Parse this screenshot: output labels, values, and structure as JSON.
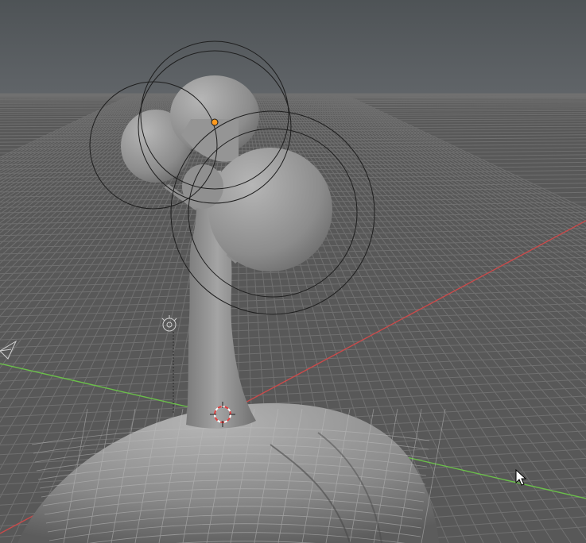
{
  "viewport": {
    "mode": "3D Viewport",
    "sky_color_top": "#4f5356",
    "sky_color_horizon": "#5f6366",
    "floor_color": "#5a5a5a",
    "grid_color": "#6e6e6e",
    "x_axis_color": "#c94a4a",
    "y_axis_color": "#6bbf4a",
    "mesh_color": "#8e8e8e",
    "gizmo_circle_color": "#1e1e1e",
    "active_point_color": "#ff9a1e"
  },
  "scene_objects": [
    {
      "name": "tree",
      "icon": "tree-mesh"
    },
    {
      "name": "ground-sphere",
      "icon": "sphere-mesh"
    },
    {
      "name": "light",
      "icon": "light-icon"
    },
    {
      "name": "camera",
      "icon": "camera-icon"
    },
    {
      "name": "3d-cursor",
      "icon": "cursor-icon"
    }
  ],
  "cursor": {
    "icon": "mouse-pointer-icon"
  }
}
